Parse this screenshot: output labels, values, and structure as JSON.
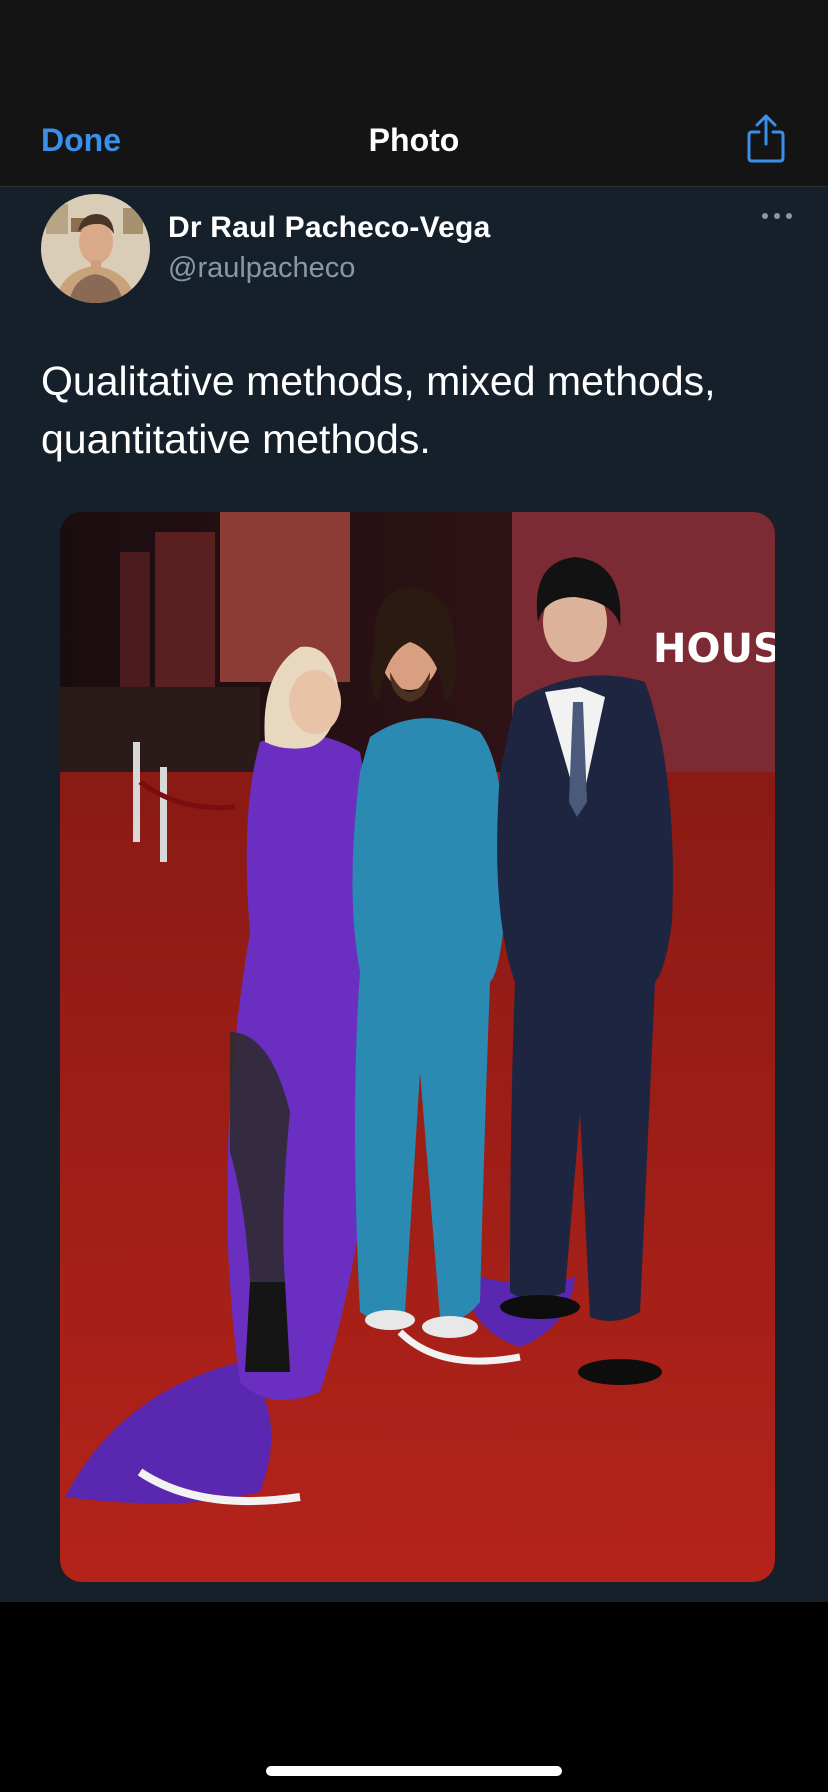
{
  "navbar": {
    "done_label": "Done",
    "title": "Photo",
    "share_icon": "share-icon"
  },
  "tweet": {
    "display_name": "Dr Raul Pacheco-Vega",
    "handle": "@raulpacheco",
    "text": "Qualitative methods, mixed methods, quantitative methods.",
    "more_icon": "more-options-icon",
    "photo_sign_text": "HOUSE O"
  },
  "colors": {
    "accent": "#3a8fe8",
    "background": "#15202b",
    "navbar": "#141414",
    "secondary_text": "#8899a6"
  }
}
